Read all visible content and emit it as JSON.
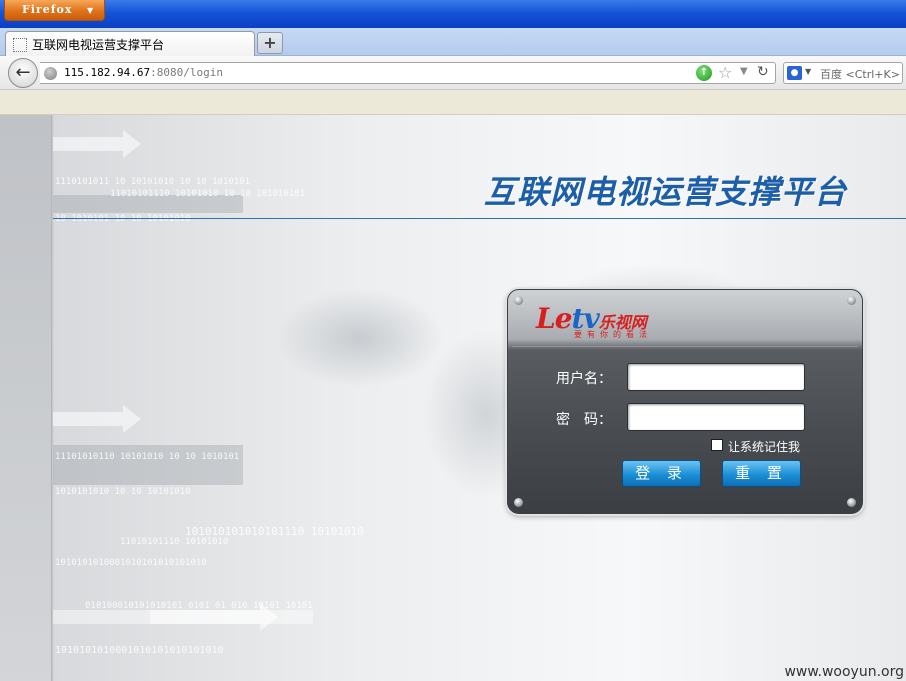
{
  "browser": {
    "app_button_label": "Firefox",
    "tab_title": "互联网电视运营支撑平台",
    "new_tab_label": "+",
    "url_host": "115.182.94.67",
    "url_path": ":8080/login",
    "search_placeholder": "百度 <Ctrl+K>"
  },
  "page": {
    "platform_title": "互联网电视运营支撑平台",
    "watermark": "www.wooyun.org",
    "background_digits": [
      "1110101011 10 10101010 10 10 1010101",
      "11010101110 10101010 10 10 101010101",
      "10 1010101 10 10 10101010",
      "11101010110 10101010 10 10 1010101",
      "1010101010 10 10 10101010",
      "101010101010101110 10101010",
      "11010101110 10101010",
      "1010101010001010101010101010",
      "010100010101010101 0101 01 010 10101 10101",
      "1010101010001010101010101010"
    ]
  },
  "login": {
    "logo": {
      "le": "Le",
      "tv": "tv",
      "cn": "乐视网",
      "slogan": "要有你的看法"
    },
    "username_label": "用户名：",
    "username_value": "",
    "password_label": "密　码：",
    "password_value": "",
    "remember_label": "让系统记住我",
    "login_button": "登 录",
    "reset_button": "重 置"
  },
  "colors": {
    "title_blue": "#1d5ea8",
    "button_blue": "#1b8fd6",
    "panel_dark": "#4a4e53",
    "logo_red": "#d81f1f"
  }
}
